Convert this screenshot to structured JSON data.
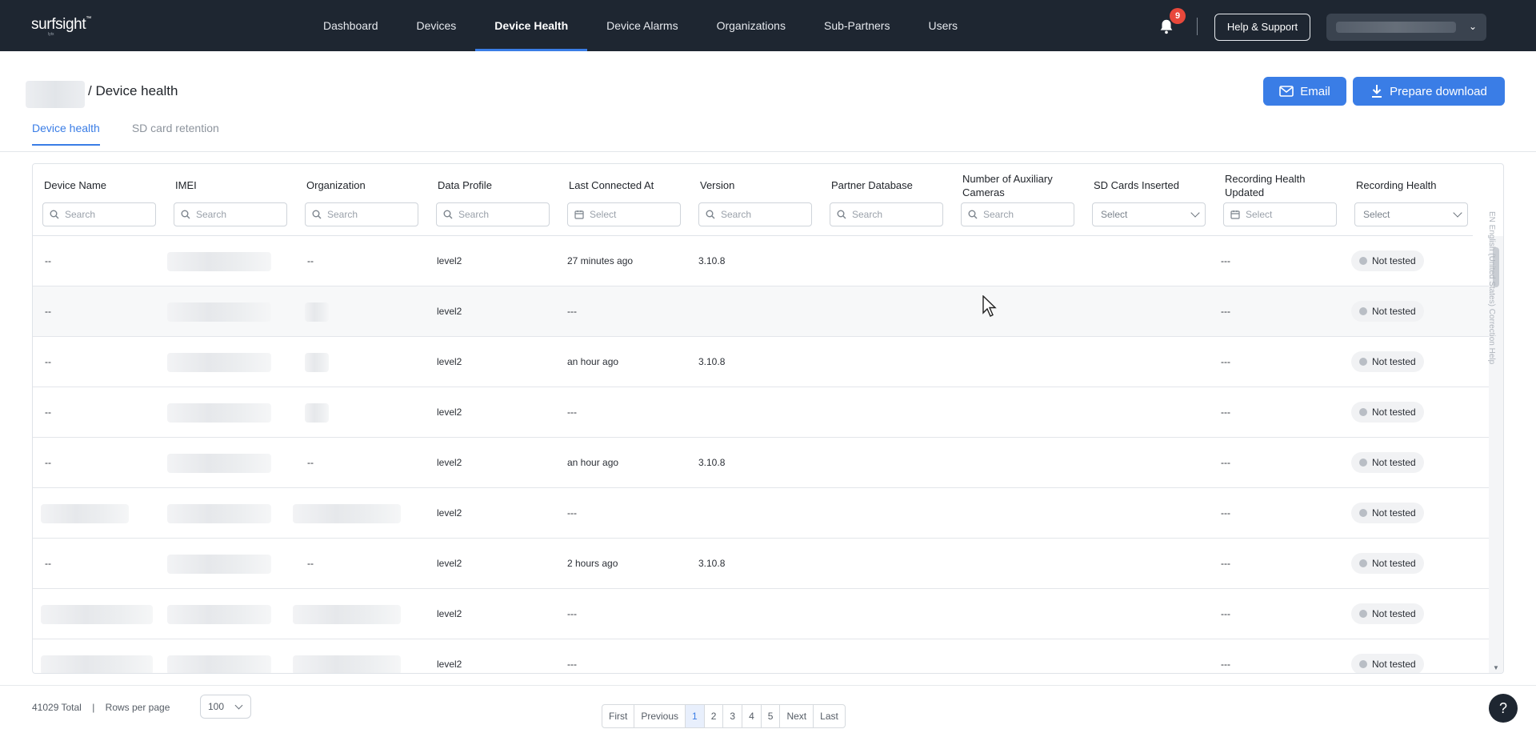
{
  "topnav": {
    "logo": "surfsight",
    "logo_sub": "lytx",
    "items": [
      {
        "label": "Dashboard"
      },
      {
        "label": "Devices"
      },
      {
        "label": "Device Health"
      },
      {
        "label": "Device Alarms"
      },
      {
        "label": "Organizations"
      },
      {
        "label": "Sub-Partners"
      },
      {
        "label": "Users"
      }
    ],
    "notification_count": "9",
    "help_label": "Help & Support"
  },
  "header": {
    "title": "/ Device health",
    "email_label": "Email",
    "download_label": "Prepare download"
  },
  "tabs": [
    {
      "label": "Device health"
    },
    {
      "label": "SD card retention"
    }
  ],
  "table": {
    "columns": [
      {
        "label": "Device Name",
        "filter": "Search",
        "kind": "search"
      },
      {
        "label": "IMEI",
        "filter": "Search",
        "kind": "search"
      },
      {
        "label": "Organization",
        "filter": "Search",
        "kind": "search"
      },
      {
        "label": "Data Profile",
        "filter": "Search",
        "kind": "search"
      },
      {
        "label": "Last Connected At",
        "filter": "Select",
        "kind": "date"
      },
      {
        "label": "Version",
        "filter": "Search",
        "kind": "search"
      },
      {
        "label": "Partner Database",
        "filter": "Search",
        "kind": "search"
      },
      {
        "label": "Number of Auxiliary Cameras",
        "filter": "Search",
        "kind": "search"
      },
      {
        "label": "SD Cards Inserted",
        "filter": "Select",
        "kind": "dropdown"
      },
      {
        "label": "Recording Health Updated",
        "filter": "Select",
        "kind": "date"
      },
      {
        "label": "Recording Health",
        "filter": "Select",
        "kind": "dropdown"
      }
    ],
    "rows": [
      {
        "device_name": "--",
        "organization": "--",
        "data_profile": "level2",
        "last_connected": "27 minutes ago",
        "version": "3.10.8",
        "rh_updated": "---",
        "recording_health": "Not tested"
      },
      {
        "device_name": "--",
        "organization": "",
        "data_profile": "level2",
        "last_connected": "---",
        "version": "",
        "rh_updated": "---",
        "recording_health": "Not tested"
      },
      {
        "device_name": "--",
        "organization": "",
        "data_profile": "level2",
        "last_connected": "an hour ago",
        "version": "3.10.8",
        "rh_updated": "---",
        "recording_health": "Not tested"
      },
      {
        "device_name": "--",
        "organization": "",
        "data_profile": "level2",
        "last_connected": "---",
        "version": "",
        "rh_updated": "---",
        "recording_health": "Not tested"
      },
      {
        "device_name": "--",
        "organization": "--",
        "data_profile": "level2",
        "last_connected": "an hour ago",
        "version": "3.10.8",
        "rh_updated": "---",
        "recording_health": "Not tested"
      },
      {
        "device_name": "",
        "organization": "",
        "data_profile": "level2",
        "last_connected": "---",
        "version": "",
        "rh_updated": "---",
        "recording_health": "Not tested"
      },
      {
        "device_name": "--",
        "organization": "--",
        "data_profile": "level2",
        "last_connected": "2 hours ago",
        "version": "3.10.8",
        "rh_updated": "---",
        "recording_health": "Not tested"
      },
      {
        "device_name": "",
        "organization": "",
        "data_profile": "level2",
        "last_connected": "---",
        "version": "",
        "rh_updated": "---",
        "recording_health": "Not tested"
      },
      {
        "device_name": "",
        "organization": "",
        "data_profile": "level2",
        "last_connected": "---",
        "version": "",
        "rh_updated": "---",
        "recording_health": "Not tested"
      }
    ]
  },
  "footer": {
    "total": "41029 Total",
    "separator": "|",
    "rows_per_page_label": "Rows per page",
    "rows_per_page_value": "100",
    "pages": [
      "First",
      "Previous",
      "1",
      "2",
      "3",
      "4",
      "5",
      "Next",
      "Last"
    ],
    "current_page": "1"
  },
  "side_widget": "EN  English (United States)   Correction   Help",
  "colors": {
    "nav_bg": "#1e2631",
    "accent": "#3a7de6",
    "badge": "#e8483b"
  }
}
